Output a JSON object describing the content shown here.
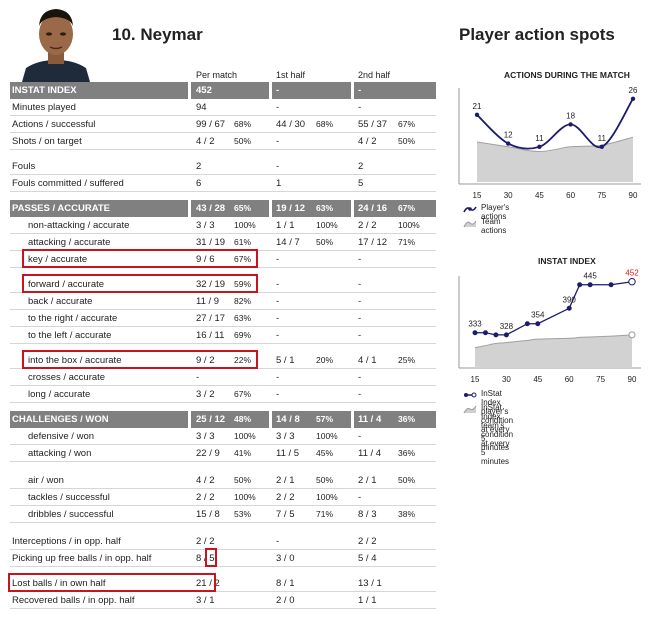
{
  "header": {
    "player_title": "10.  Neymar",
    "spots_title": "Player action spots"
  },
  "columns": {
    "per_match": "Per match",
    "first_half": "1st half",
    "second_half": "2nd half"
  },
  "rows": [
    {
      "type": "header",
      "label": "INSTAT INDEX",
      "pm": "452",
      "pmp": "",
      "h1": "-",
      "h1p": "",
      "h2": "-",
      "h2p": ""
    },
    {
      "type": "row",
      "label": "Minutes played",
      "pm": "94",
      "pmp": "",
      "h1": "-",
      "h1p": "",
      "h2": "-",
      "h2p": ""
    },
    {
      "type": "row",
      "label": "Actions / successful",
      "pm": "99 / 67",
      "pmp": "68%",
      "h1": "44 / 30",
      "h1p": "68%",
      "h2": "55 / 37",
      "h2p": "67%"
    },
    {
      "type": "row",
      "label": "Shots / on target",
      "pm": "4 / 2",
      "pmp": "50%",
      "h1": "-",
      "h1p": "",
      "h2": "4 / 2",
      "h2p": "50%"
    },
    {
      "type": "space"
    },
    {
      "type": "row",
      "label": "Fouls",
      "pm": "2",
      "pmp": "",
      "h1": "-",
      "h1p": "",
      "h2": "2",
      "h2p": ""
    },
    {
      "type": "row",
      "label": "Fouls committed / suffered",
      "pm": "6",
      "pmp": "",
      "h1": "1",
      "h1p": "",
      "h2": "5",
      "h2p": ""
    },
    {
      "type": "space"
    },
    {
      "type": "header",
      "label": "PASSES / ACCURATE",
      "pm": "43 / 28",
      "pmp": "65%",
      "h1": "19 / 12",
      "h1p": "63%",
      "h2": "24 / 16",
      "h2p": "67%"
    },
    {
      "type": "row",
      "indent": true,
      "label": "non-attacking / accurate",
      "pm": "3 / 3",
      "pmp": "100%",
      "h1": "1 / 1",
      "h1p": "100%",
      "h2": "2 / 2",
      "h2p": "100%"
    },
    {
      "type": "row",
      "indent": true,
      "label": "attacking / accurate",
      "pm": "31 / 19",
      "pmp": "61%",
      "h1": "14 / 7",
      "h1p": "50%",
      "h2": "17 / 12",
      "h2p": "71%"
    },
    {
      "type": "row",
      "indent": true,
      "label": "key / accurate",
      "pm": "9 / 6",
      "pmp": "67%",
      "h1": "-",
      "h1p": "",
      "h2": "-",
      "h2p": "",
      "box": true
    },
    {
      "type": "space"
    },
    {
      "type": "row",
      "indent": true,
      "label": "forward / accurate",
      "pm": "32 / 19",
      "pmp": "59%",
      "h1": "-",
      "h1p": "",
      "h2": "-",
      "h2p": "",
      "box": true
    },
    {
      "type": "row",
      "indent": true,
      "label": "back / accurate",
      "pm": "11 / 9",
      "pmp": "82%",
      "h1": "-",
      "h1p": "",
      "h2": "-",
      "h2p": ""
    },
    {
      "type": "row",
      "indent": true,
      "label": "to the right / accurate",
      "pm": "27 / 17",
      "pmp": "63%",
      "h1": "-",
      "h1p": "",
      "h2": "-",
      "h2p": ""
    },
    {
      "type": "row",
      "indent": true,
      "label": "to the left / accurate",
      "pm": "16 / 11",
      "pmp": "69%",
      "h1": "-",
      "h1p": "",
      "h2": "-",
      "h2p": ""
    },
    {
      "type": "space"
    },
    {
      "type": "row",
      "indent": true,
      "label": "into the box / accurate",
      "pm": "9 / 2",
      "pmp": "22%",
      "h1": "5 / 1",
      "h1p": "20%",
      "h2": "4 / 1",
      "h2p": "25%",
      "box": true
    },
    {
      "type": "row",
      "indent": true,
      "label": "crosses / accurate",
      "pm": "-",
      "pmp": "",
      "h1": "-",
      "h1p": "",
      "h2": "-",
      "h2p": ""
    },
    {
      "type": "row",
      "indent": true,
      "label": "long / accurate",
      "pm": "3 / 2",
      "pmp": "67%",
      "h1": "-",
      "h1p": "",
      "h2": "-",
      "h2p": ""
    },
    {
      "type": "space"
    },
    {
      "type": "header",
      "label": "CHALLENGES / WON",
      "pm": "25 / 12",
      "pmp": "48%",
      "h1": "14 / 8",
      "h1p": "57%",
      "h2": "11 / 4",
      "h2p": "36%"
    },
    {
      "type": "row",
      "indent": true,
      "label": "defensive / won",
      "pm": "3 / 3",
      "pmp": "100%",
      "h1": "3 / 3",
      "h1p": "100%",
      "h2": "-",
      "h2p": ""
    },
    {
      "type": "row",
      "indent": true,
      "label": "attacking / won",
      "pm": "22 / 9",
      "pmp": "41%",
      "h1": "11 / 5",
      "h1p": "45%",
      "h2": "11 / 4",
      "h2p": "36%"
    },
    {
      "type": "space2"
    },
    {
      "type": "row",
      "indent": true,
      "label": "air / won",
      "pm": "4 / 2",
      "pmp": "50%",
      "h1": "2 / 1",
      "h1p": "50%",
      "h2": "2 / 1",
      "h2p": "50%"
    },
    {
      "type": "row",
      "indent": true,
      "label": "tackles / successful",
      "pm": "2 / 2",
      "pmp": "100%",
      "h1": "2 / 2",
      "h1p": "100%",
      "h2": "-",
      "h2p": ""
    },
    {
      "type": "row",
      "indent": true,
      "label": "dribbles / successful",
      "pm": "15 / 8",
      "pmp": "53%",
      "h1": "7 / 5",
      "h1p": "71%",
      "h2": "8 / 3",
      "h2p": "38%"
    },
    {
      "type": "space2"
    },
    {
      "type": "row",
      "label": "Interceptions / in opp. half",
      "pm": "2 / 2",
      "pmp": "",
      "h1": "-",
      "h1p": "",
      "h2": "2 / 2",
      "h2p": ""
    },
    {
      "type": "row",
      "label": "Picking up free balls / in opp. half",
      "pm": "8 / 5",
      "pmp": "",
      "h1": "3 / 0",
      "h1p": "",
      "h2": "5 / 4",
      "h2p": "",
      "pmbox": true
    },
    {
      "type": "space"
    },
    {
      "type": "row",
      "label": "Lost balls / in own half",
      "pm": "21 / 2",
      "pmp": "",
      "h1": "8 / 1",
      "h1p": "",
      "h2": "13 / 1",
      "h2p": "",
      "box": true
    },
    {
      "type": "row",
      "label": "Recovered balls / in opp. half",
      "pm": "3 / 1",
      "pmp": "",
      "h1": "2 / 0",
      "h1p": "",
      "h2": "1 / 1",
      "h2p": ""
    }
  ],
  "chart_data": [
    {
      "type": "line",
      "title": "ACTIONS DURING THE MATCH",
      "x": [
        15,
        30,
        45,
        60,
        75,
        90
      ],
      "series": [
        {
          "name": "Player's actions",
          "values": [
            21,
            12,
            11,
            18,
            11,
            26
          ],
          "color": "#1c1c6e"
        },
        {
          "name": "Team actions",
          "values": [
            12.5,
            11,
            9.5,
            11,
            11.5,
            14
          ],
          "color": "#c8c8c8"
        }
      ],
      "ylim": [
        0,
        30
      ]
    },
    {
      "type": "line",
      "title": "INSTAT INDEX",
      "x": [
        15,
        30,
        45,
        60,
        75,
        90
      ],
      "series": [
        {
          "name": "InStat Index player's condition at every 5 minutes",
          "values": [
            333,
            333,
            328,
            328,
            354,
            354,
            390,
            445,
            445,
            445,
            452
          ],
          "x_points": [
            15,
            20,
            25,
            30,
            40,
            45,
            60,
            65,
            70,
            80,
            90
          ],
          "color": "#1c1c6e",
          "labels": [
            [
              "333",
              15
            ],
            [
              "328",
              30
            ],
            [
              "354",
              45
            ],
            [
              "390",
              60
            ],
            [
              "445",
              70
            ],
            [
              "452",
              90
            ]
          ]
        },
        {
          "name": "InStat Index team's condition at every 5 minutes",
          "values": [
            298,
            303,
            308,
            310,
            315,
            318,
            320,
            322,
            323,
            325,
            328
          ],
          "x_points": [
            15,
            20,
            25,
            30,
            40,
            45,
            60,
            65,
            70,
            80,
            90
          ],
          "color": "#c8c8c8"
        }
      ],
      "last_label_color": "#d81e1e"
    }
  ]
}
